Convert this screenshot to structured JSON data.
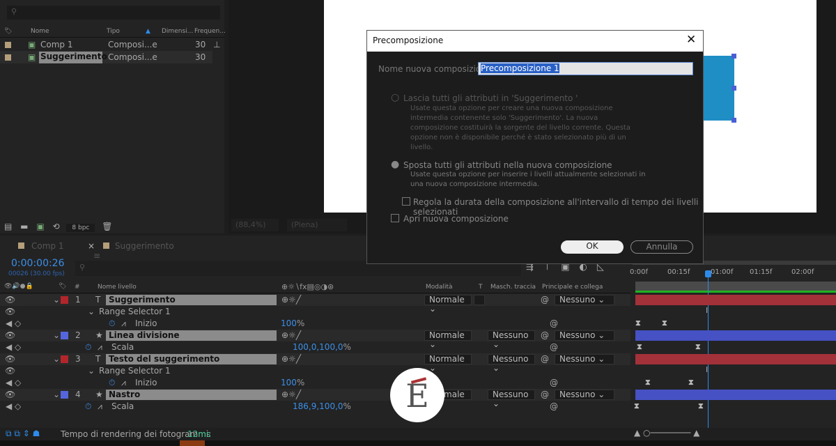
{
  "project": {
    "columns": [
      "Nome",
      "Tipo",
      "Dimensi...",
      "Frequen..."
    ],
    "items": [
      {
        "name": "Comp 1",
        "type": "Composi...e",
        "fps": "30"
      },
      {
        "name": "Suggerimento",
        "type": "Composi...e",
        "fps": "30"
      }
    ],
    "bpc": "8 bpc"
  },
  "viewer": {
    "zoom": "(88,4%)",
    "resolution": "(Piena)"
  },
  "dialog": {
    "title": "Precomposizione",
    "name_label": "Nome nuova composizione:",
    "name_value": "Precomposizione 1",
    "opt1": "Lascia tutti gli attributi in 'Suggerimento '",
    "opt1_desc": "Usate questa opzione per creare una nuova composizione intermedia contenente solo 'Suggerimento'. La nuova composizione costituirà la sorgente del livello corrente. Questa opzione non è disponibile perché è stato selezionato più di un livello.",
    "opt2": "Sposta tutti gli attributi nella nuova composizione",
    "opt2_desc": "Usate questa opzione per inserire i livelli attualmente selezionati in una nuova composizione intermedia.",
    "check1": "Regola la durata della composizione all'intervallo di tempo dei livelli selezionati",
    "check2": "Apri nuova composizione",
    "ok": "OK",
    "cancel": "Annulla"
  },
  "timeline": {
    "tabs": [
      "Comp 1",
      "Suggerimento"
    ],
    "timecode": "0:00:00:26",
    "frames": "00026 (30.00 fps)",
    "headers": {
      "num": "#",
      "name": "Nome livello",
      "mode": "Modalità",
      "t": "T",
      "matte": "Masch. traccia",
      "parent": "Principale e collega"
    },
    "ruler": [
      "0:00f",
      "00:15f",
      "01:00f",
      "01:15f",
      "02:00f"
    ],
    "layers": [
      {
        "num": "1",
        "name": "Suggerimento",
        "mode": "Normale",
        "matte": "",
        "parent": "Nessuno",
        "sub": "Range Selector 1",
        "prop": "Inizio",
        "value": "100",
        "unit": "%",
        "color": "#b2262b"
      },
      {
        "num": "2",
        "name": "Linea divisione",
        "mode": "Normale",
        "matte": "Nessuno",
        "parent": "Nessuno",
        "prop": "Scala",
        "value": "100,0,100,0",
        "unit": "%",
        "color": "#5566dd"
      },
      {
        "num": "3",
        "name": "Testo del suggerimento",
        "mode": "Normale",
        "matte": "Nessuno",
        "parent": "Nessuno",
        "sub": "Range Selector 1",
        "prop": "Inizio",
        "value": "100",
        "unit": "%",
        "color": "#b2262b"
      },
      {
        "num": "4",
        "name": "Nastro",
        "mode": "Normale",
        "matte": "Nessuno",
        "parent": "Nessuno",
        "prop": "Scala",
        "value": "186,9,100,0",
        "unit": "%",
        "color": "#5566dd"
      }
    ]
  },
  "status": {
    "label": "Tempo di rendering dei fotogrammi:",
    "value": "12ms"
  },
  "logo": {
    "letter": "E"
  }
}
